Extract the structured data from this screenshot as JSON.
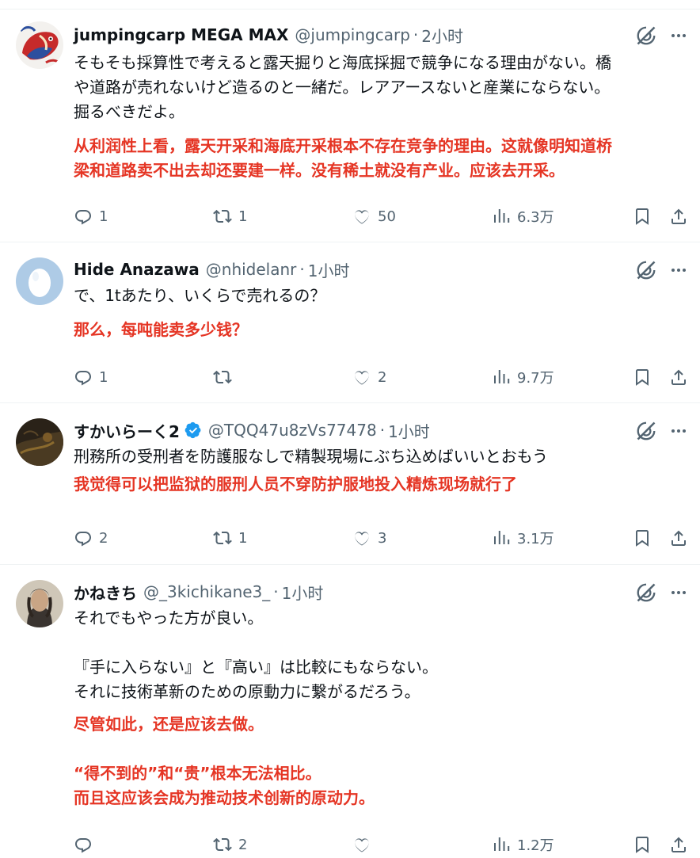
{
  "tweets": [
    {
      "name": "jumpingcarp MEGA MAX",
      "handle": "@jumpingcarp",
      "time": "2小时",
      "verified": false,
      "text_jp": [
        "そもそも採算性で考えると露天掘りと海底採掘で競争になる理由がない。橋",
        "や道路が売れないけど造るのと一緒だ。レアアースないと産業にならない。",
        "掘るべきだよ。"
      ],
      "text_cn": [
        "从利润性上看，露天开采和海底开采根本不存在竞争的理由。这就像明知道桥",
        "梁和道路卖不出去却还要建一样。没有稀土就没有产业。应该去开采。"
      ],
      "replies": "1",
      "reposts": "1",
      "likes": "50",
      "views": "6.3万"
    },
    {
      "name": "Hide Anazawa",
      "handle": "@nhidelanr",
      "time": "1小时",
      "verified": false,
      "text_jp": [
        "で、1tあたり、いくらで売れるの？"
      ],
      "text_cn": [
        "那么，每吨能卖多少钱？"
      ],
      "replies": "1",
      "reposts": "",
      "likes": "2",
      "views": "9.7万"
    },
    {
      "name": "すかいらーく2",
      "handle": "@TQQ47u8zVs77478",
      "time": "1小时",
      "verified": true,
      "text_jp": [
        "刑務所の受刑者を防護服なしで精製現場にぶち込めばいいとおもう"
      ],
      "text_cn": [
        "我觉得可以把监狱的服刑人员不穿防护服地投入精炼现场就行了"
      ],
      "replies": "2",
      "reposts": "1",
      "likes": "3",
      "views": "3.1万"
    },
    {
      "name": "かねきち",
      "handle": "@_3kichikane3_",
      "time": "1小时",
      "verified": false,
      "text_jp_a": [
        "それでもやった方が良い。"
      ],
      "text_jp_b": [
        "『手に入らない』と『高い』は比較にもならない。",
        "それに技術革新のための原動力に繋がるだろう。"
      ],
      "text_cn_a": [
        "尽管如此，还是应该去做。"
      ],
      "text_cn_b": [
        "“得不到的”和“贵”根本无法相比。",
        "而且这应该会成为推动技术创新的原动力。"
      ],
      "replies": "",
      "reposts": "2",
      "likes": "",
      "views": "1.2万"
    }
  ],
  "colors": {
    "text": "#0f1419",
    "secondary": "#536471",
    "translation": "#e53524",
    "verified": "#1d9bf0",
    "divider": "#eff3f4"
  },
  "icons": [
    "reply-icon",
    "repost-icon",
    "like-icon",
    "views-icon",
    "bookmark-icon",
    "share-icon",
    "grok-icon",
    "more-icon",
    "verified-badge-icon"
  ]
}
